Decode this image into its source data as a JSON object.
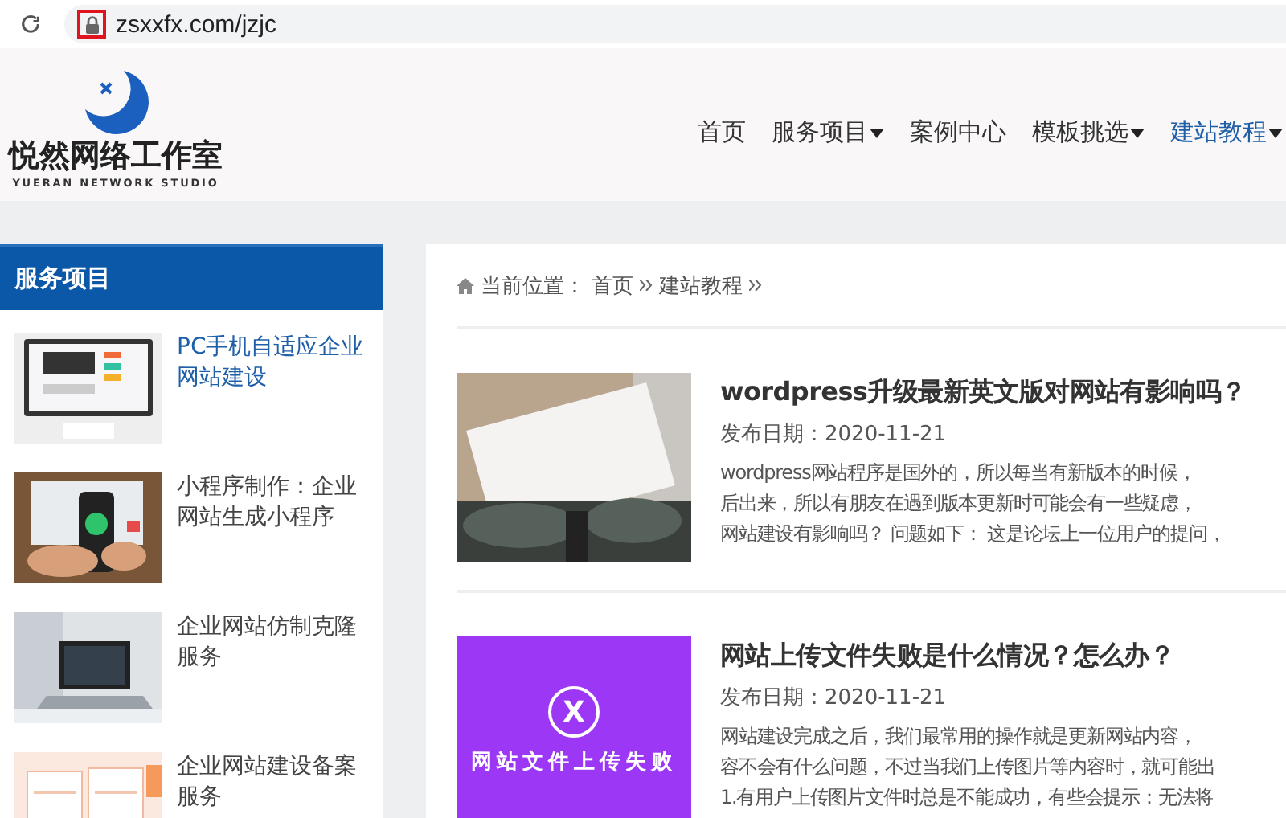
{
  "browser": {
    "url": "zsxxfx.com/jzjc"
  },
  "logo": {
    "name": "悦然网络工作室",
    "subtitle": "YUERAN NETWORK STUDIO"
  },
  "nav": [
    {
      "label": "首页",
      "dropdown": false,
      "selected": false
    },
    {
      "label": "服务项目",
      "dropdown": true,
      "selected": false
    },
    {
      "label": "案例中心",
      "dropdown": false,
      "selected": false
    },
    {
      "label": "模板挑选",
      "dropdown": true,
      "selected": false
    },
    {
      "label": "建站教程",
      "dropdown": true,
      "selected": true
    }
  ],
  "sidebar": {
    "title": "服务项目",
    "items": [
      {
        "title": "PC手机自适应企业网站建设",
        "selected": true
      },
      {
        "title": "小程序制作：企业网站生成小程序",
        "selected": false
      },
      {
        "title": "企业网站仿制克隆服务",
        "selected": false
      },
      {
        "title": "企业网站建设备案服务",
        "selected": false
      }
    ]
  },
  "breadcrumb": {
    "label": "当前位置：",
    "items": [
      "首页",
      "建站教程"
    ]
  },
  "articles": [
    {
      "title": "wordpress升级最新英文版对网站有影响吗？",
      "date": "发布日期：2020-11-21",
      "thumb": {
        "kind": "picture"
      },
      "excerpt": [
        "wordpress网站程序是国外的，所以每当有新版本的时候，",
        "后出来，所以有朋友在遇到版本更新时可能会有一些疑虑，",
        "网站建设有影响吗？ 问题如下： 这是论坛上一位用户的提问，"
      ]
    },
    {
      "title": "网站上传文件失败是什么情况？怎么办？",
      "date": "发布日期：2020-11-21",
      "thumb": {
        "kind": "banner",
        "symbol": "X",
        "caption": "网站文件上传失败"
      },
      "excerpt": [
        "网站建设完成之后，我们最常用的操作就是更新网站内容，",
        "容不会有什么问题，不过当我们上传图片等内容时，就可能出",
        "1.有用户上传图片文件时总是不能成功，有些会提示：无法将"
      ]
    }
  ]
}
